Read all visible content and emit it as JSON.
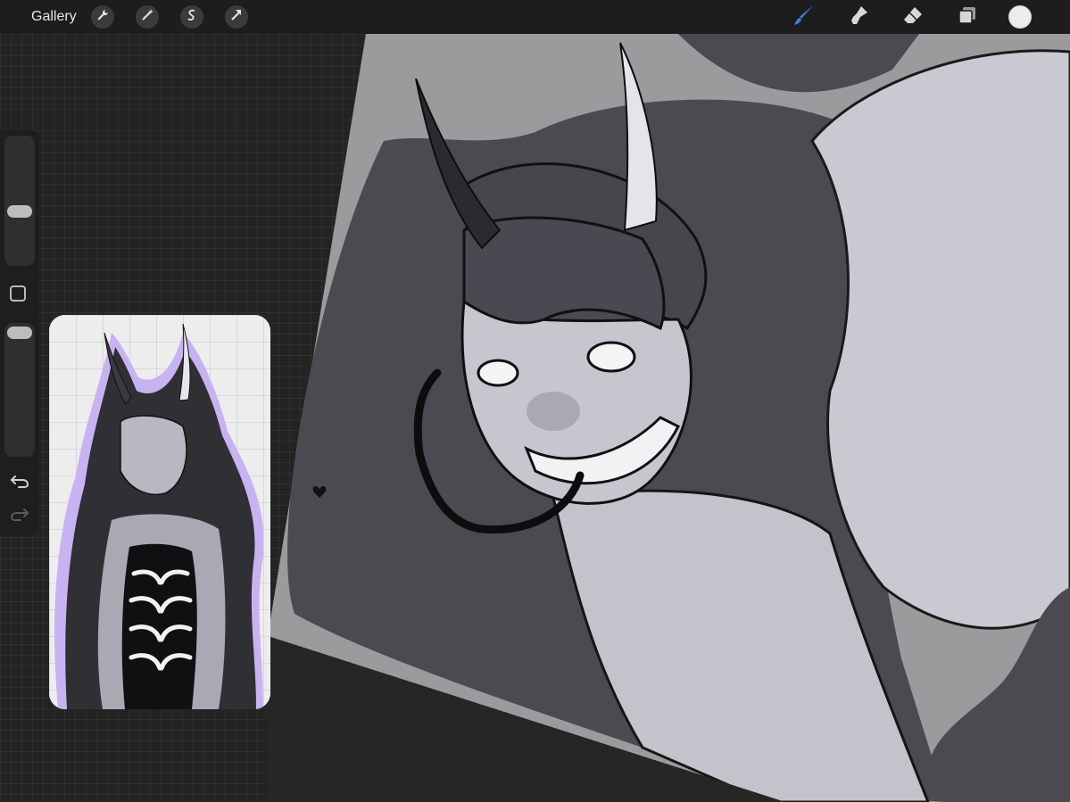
{
  "topbar": {
    "gallery_label": "Gallery",
    "left_tools": [
      "wrench-icon",
      "magic-wand-icon",
      "selection-icon",
      "transform-arrow-icon"
    ],
    "right_tools": [
      "brush-icon",
      "smudge-icon",
      "eraser-icon",
      "layers-icon"
    ],
    "active_tool": "brush",
    "active_tool_color": "#3f7de8",
    "current_color": "#ececec"
  },
  "sidebar": {
    "brush_size_fraction": 0.58,
    "opacity_fraction": 0.96,
    "controls": [
      "brush-size-slider",
      "modify-button",
      "opacity-slider",
      "undo-icon",
      "redo-icon"
    ]
  },
  "colors": {
    "app_background": "#242424",
    "canvas_grey": "#9b9b9d",
    "hair_dark": "#4c4a51",
    "skin": "#c9c9d1",
    "outline": "#121212",
    "reference_glow": "#c8b3f2"
  }
}
